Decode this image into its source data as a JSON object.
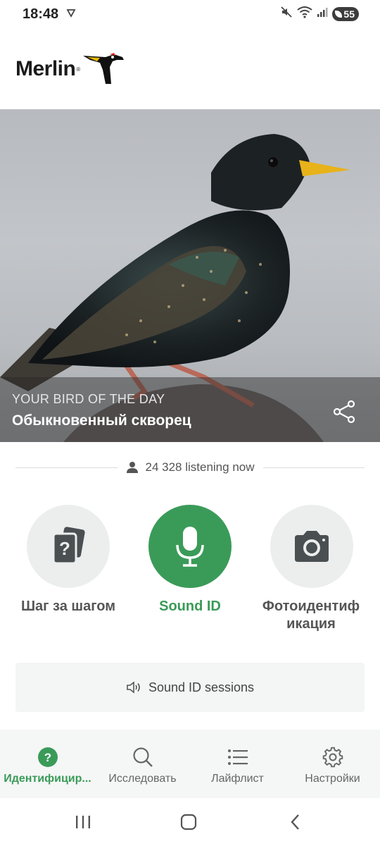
{
  "status": {
    "time": "18:48",
    "battery": "55"
  },
  "app": {
    "logo_text": "Merlin",
    "logo_reg": "®"
  },
  "hero": {
    "label": "YOUR BIRD OF THE DAY",
    "bird_name": "Обыкновенный скворец"
  },
  "listening": {
    "text": "24 328 listening now"
  },
  "actions": {
    "step_by_step": "Шаг за шагом",
    "sound_id": "Sound ID",
    "photo_id_line1": "Фотоидентиф",
    "photo_id_line2": "икация"
  },
  "sessions": {
    "label": "Sound ID sessions"
  },
  "bottom_nav": {
    "identify": "Идентифицир...",
    "explore": "Исследовать",
    "lifelist": "Лайфлист",
    "settings": "Настройки"
  },
  "colors": {
    "accent": "#3a9b58"
  }
}
